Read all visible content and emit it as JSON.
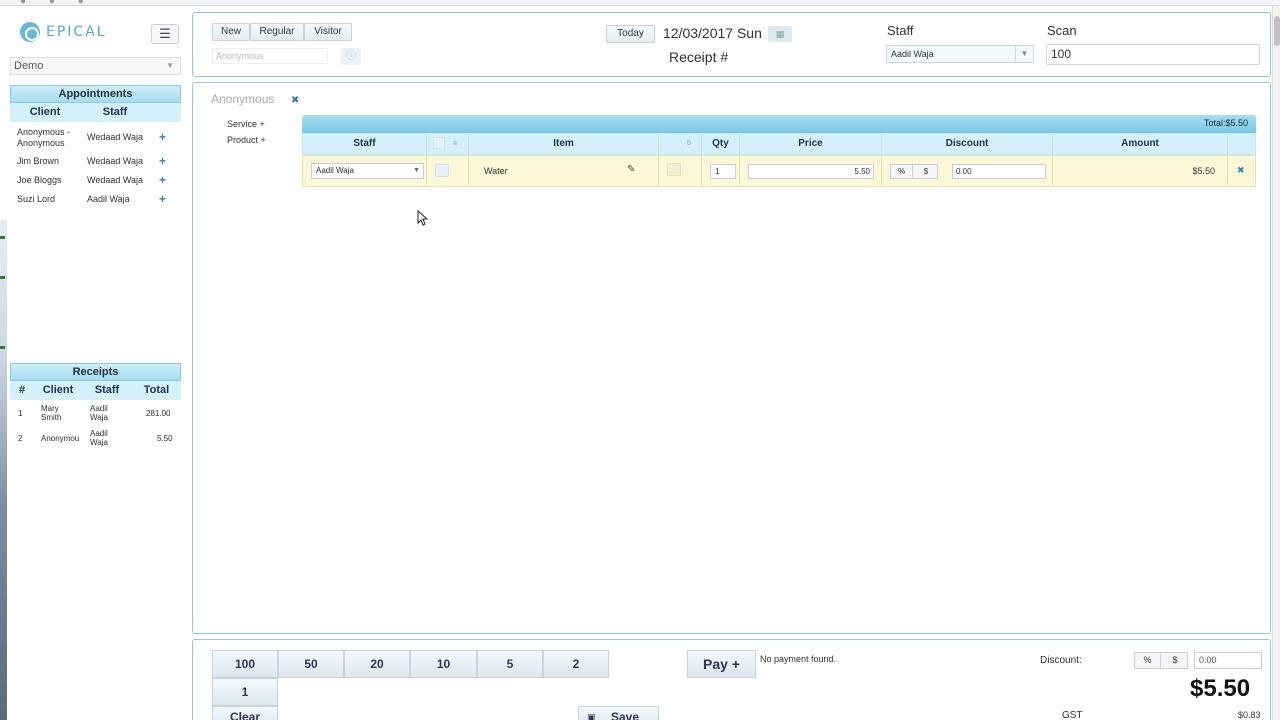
{
  "sidebar": {
    "logo_text": "EPICAL",
    "location": "Demo",
    "appointments": {
      "title": "Appointments",
      "columns": [
        "Client",
        "Staff"
      ],
      "rows": [
        {
          "client": "Anonymous - Anonymous",
          "staff": "Wedaad Waja"
        },
        {
          "client": "Jim Brown",
          "staff": "Wedaad Waja"
        },
        {
          "client": "Joe Bloggs",
          "staff": "Wedaad Waja"
        },
        {
          "client": "Suzi Lord",
          "staff": "Aadil Waja"
        }
      ]
    },
    "receipts": {
      "title": "Receipts",
      "columns": [
        "#",
        "Client",
        "Staff",
        "Total"
      ],
      "rows": [
        {
          "num": "1",
          "client": "Mary Smith",
          "staff": "Aadil Waja",
          "total": "281.00"
        },
        {
          "num": "2",
          "client": "Anonymou",
          "staff": "Aadil Waja",
          "total": "5.50"
        }
      ]
    }
  },
  "header": {
    "client_type_buttons": [
      "New",
      "Regular",
      "Visitor"
    ],
    "client_placeholder": "Anonymous",
    "today_label": "Today",
    "date": "12/03/2017 Sun",
    "receipt_title": "Receipt #",
    "staff_label": "Staff",
    "staff_value": "Aadil Waja",
    "scan_label": "Scan",
    "scan_value": "100"
  },
  "main": {
    "client_tab": "Anonymous",
    "add_links": [
      "Service +",
      "Product +"
    ],
    "total_label": "Total:$5.50",
    "columns": [
      "Staff",
      "Item",
      "Qty",
      "Price",
      "Discount",
      "Amount"
    ],
    "line_items": [
      {
        "staff": "Aadil Waja",
        "item": "Water",
        "qty": "1",
        "price": "5.50",
        "disc_pct": "%",
        "disc_dollar": "$",
        "discount": "0.00",
        "amount": "$5.50"
      }
    ]
  },
  "footer": {
    "cash_buttons": [
      "100",
      "50",
      "20",
      "10",
      "5",
      "2",
      "1"
    ],
    "clear_label": "Clear",
    "save_label": "Save",
    "pay_label": "Pay +",
    "payment_status": "No payment found.",
    "discount_label": "Discount:",
    "discount_pct": "%",
    "discount_dollar": "$",
    "discount_value": "0.00",
    "grand_total": "$5.50",
    "gst_label": "GST",
    "gst_value": "$0.83"
  },
  "colors": {
    "accent": "#8fcbe2",
    "header_bg": "#d4f0fb",
    "row_highlight": "#faf8d6",
    "link": "#3a7fb0"
  }
}
